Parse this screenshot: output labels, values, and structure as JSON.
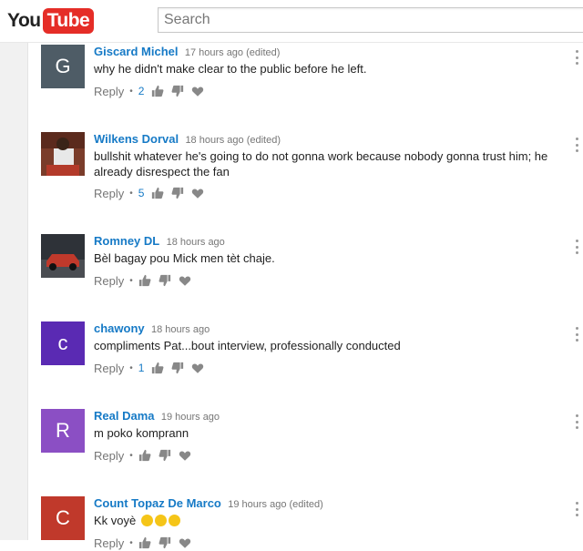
{
  "header": {
    "logo_you": "You",
    "logo_tube": "Tube",
    "search_placeholder": "Search"
  },
  "colors": {
    "link_blue": "#167ac6",
    "brand_red": "#e52d27"
  },
  "comments": [
    {
      "author": "Giscard Michel",
      "time": "17 hours ago (edited)",
      "text": "why he didn't make clear to the public before he left.",
      "reply_label": "Reply",
      "likes": "2",
      "avatar_letter": "G",
      "avatar_color": "#4e5c66"
    },
    {
      "author": "Wilkens Dorval",
      "time": "18 hours ago (edited)",
      "text": "bullshit whatever he's going to do not gonna work because nobody gonna trust him; he already disrespect the fan",
      "reply_label": "Reply",
      "likes": "5",
      "avatar_letter": "",
      "avatar_color": "#7a3c2a"
    },
    {
      "author": "Romney DL",
      "time": "18 hours ago",
      "text": "Bèl bagay pou Mick men tèt chaje.",
      "reply_label": "Reply",
      "likes": "",
      "avatar_letter": "",
      "avatar_color": "#3b3f45"
    },
    {
      "author": "chawony",
      "time": "18 hours ago",
      "text": "compliments Pat...bout interview, professionally conducted",
      "reply_label": "Reply",
      "likes": "1",
      "avatar_letter": "c",
      "avatar_color": "#5a2ab3"
    },
    {
      "author": "Real Dama",
      "time": "19 hours ago",
      "text": "m poko komprann",
      "reply_label": "Reply",
      "likes": "",
      "avatar_letter": "R",
      "avatar_color": "#8b4fc4"
    },
    {
      "author": "Count Topaz De Marco",
      "time": "19 hours ago (edited)",
      "text": "Kk voyè",
      "reply_label": "Reply",
      "likes": "",
      "avatar_letter": "C",
      "avatar_color": "#c0392b"
    }
  ]
}
